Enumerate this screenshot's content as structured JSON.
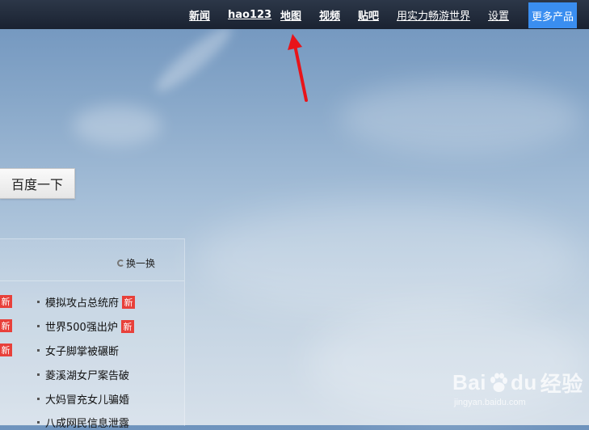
{
  "topbar": {
    "links": [
      {
        "label": "新闻"
      },
      {
        "label": "hao123"
      },
      {
        "label": "地图"
      },
      {
        "label": "视频"
      },
      {
        "label": "贴吧"
      },
      {
        "label": "用实力畅游世界"
      },
      {
        "label": "设置"
      }
    ],
    "more_label": "更多产品"
  },
  "search": {
    "button_label": "百度一下"
  },
  "hot": {
    "refresh_label": "换一换",
    "items": [
      {
        "title": "模拟攻占总统府",
        "badge": "新"
      },
      {
        "title": "世界500强出炉",
        "badge": "新"
      },
      {
        "title": "女子脚掌被碾断",
        "badge": ""
      },
      {
        "title": "菱溪湖女尸案告破",
        "badge": ""
      },
      {
        "title": "大妈冒充女儿骗婚",
        "badge": ""
      },
      {
        "title": "八成网民信息泄露",
        "badge": ""
      }
    ],
    "left_edge_badges": [
      "新",
      "新",
      "新"
    ]
  },
  "watermark": {
    "brand_left": "Bai",
    "brand_right": "du",
    "brand_cn": "经验",
    "url": "jingyan.baidu.com"
  },
  "colors": {
    "topbar": "#1f2837",
    "accent": "#3a8ef0",
    "badge": "#e8403a",
    "arrow": "#e8141a"
  }
}
